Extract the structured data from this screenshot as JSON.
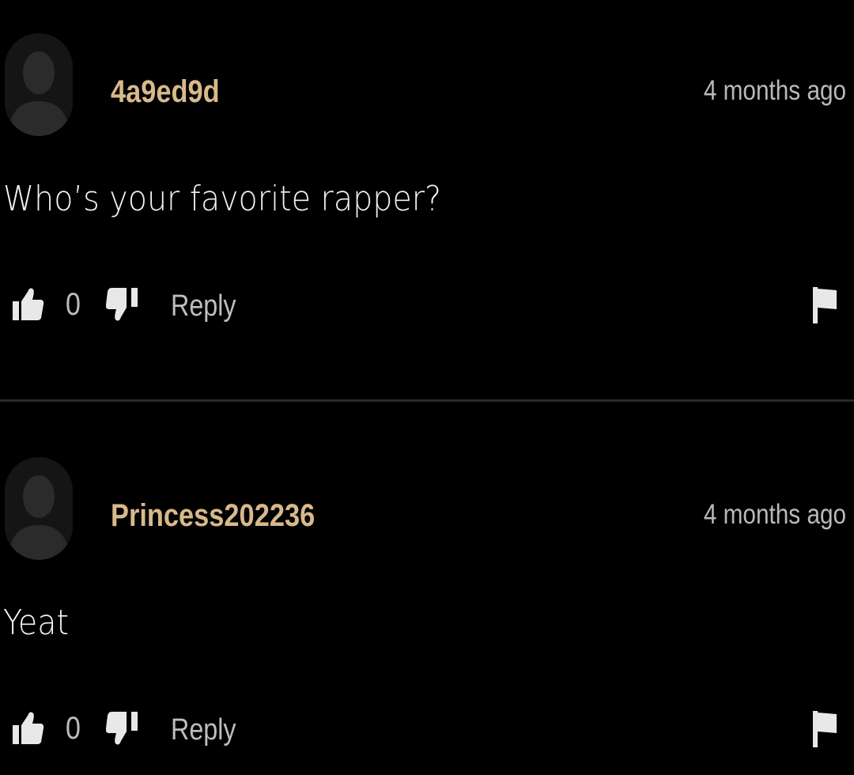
{
  "comments": [
    {
      "username": "4a9ed9d",
      "timestamp": "4 months ago",
      "text": "Who’s your favorite rapper?",
      "likes": "0",
      "reply_label": "Reply",
      "avatar_icon": "default-avatar-icon"
    },
    {
      "username": "Princess202236",
      "timestamp": "4 months ago",
      "text": "Yeat",
      "likes": "0",
      "reply_label": "Reply",
      "avatar_icon": "default-avatar-icon"
    }
  ],
  "icons": {
    "like": "thumbs-up-icon",
    "dislike": "thumbs-down-icon",
    "report": "flag-icon"
  },
  "colors": {
    "background": "#000000",
    "username": "#d8b98a",
    "text": "#f2f2f2",
    "muted": "#bdbdbd",
    "divider": "#2a2a2a"
  }
}
